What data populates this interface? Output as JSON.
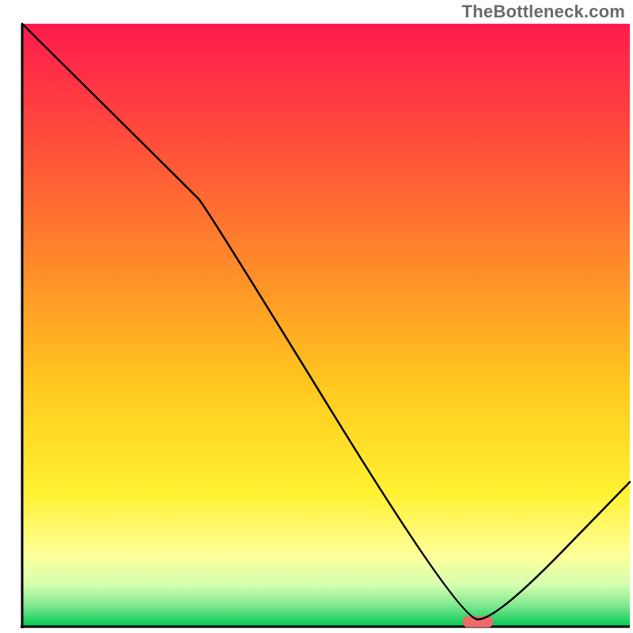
{
  "watermark": "TheBottleneck.com",
  "chart_data": {
    "type": "line",
    "title": "",
    "xlabel": "",
    "ylabel": "",
    "xlim": [
      0,
      100
    ],
    "ylim": [
      0,
      100
    ],
    "grid": false,
    "legend": false,
    "annotations": [],
    "background_gradient": {
      "stops": [
        {
          "offset": 0.0,
          "color": "#ff1a4d"
        },
        {
          "offset": 0.2,
          "color": "#ff4f3a"
        },
        {
          "offset": 0.4,
          "color": "#ff8a2a"
        },
        {
          "offset": 0.6,
          "color": "#ffc81e"
        },
        {
          "offset": 0.78,
          "color": "#fff233"
        },
        {
          "offset": 0.88,
          "color": "#ffff99"
        },
        {
          "offset": 0.93,
          "color": "#d6ffb0"
        },
        {
          "offset": 0.965,
          "color": "#7fe890"
        },
        {
          "offset": 1.0,
          "color": "#00c853"
        }
      ]
    },
    "series": [
      {
        "name": "bottleneck-curve",
        "color": "#000000",
        "x": [
          0,
          28,
          30,
          72,
          78,
          100
        ],
        "values": [
          100,
          72,
          70,
          1.2,
          1.2,
          24
        ]
      }
    ],
    "marker": {
      "name": "optimal-marker",
      "x_center": 75,
      "y": 0.8,
      "width_x": 5,
      "height_y": 1.8,
      "color": "#ef6b6b"
    },
    "axes": {
      "left": {
        "x": 3.5,
        "y0": 0,
        "y1": 100
      },
      "bottom": {
        "y": 1.0,
        "x0": 3.5,
        "x1": 100
      }
    }
  }
}
